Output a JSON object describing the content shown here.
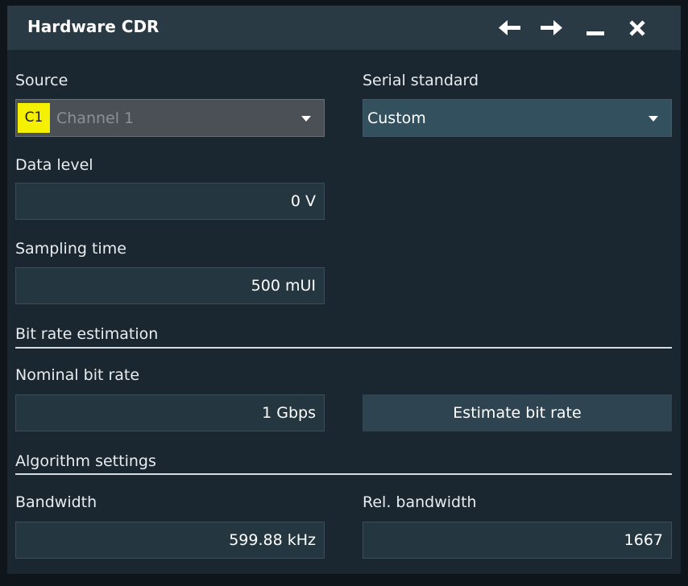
{
  "title": "Hardware CDR",
  "titlebar": {
    "icons": [
      "arrow-left-icon",
      "arrow-right-icon",
      "minimize-icon",
      "close-icon"
    ]
  },
  "source": {
    "label": "Source",
    "badge": "C1",
    "badge_color": "#f5f000",
    "value": "Channel 1"
  },
  "serial_standard": {
    "label": "Serial standard",
    "value": "Custom"
  },
  "data_level": {
    "label": "Data level",
    "value": "0 V"
  },
  "sampling_time": {
    "label": "Sampling time",
    "value": "500 mUI"
  },
  "bit_rate_estimation": {
    "heading": "Bit rate estimation",
    "nominal_label": "Nominal bit rate",
    "nominal_value": "1 Gbps",
    "estimate_button": "Estimate bit rate"
  },
  "algorithm_settings": {
    "heading": "Algorithm settings",
    "bandwidth_label": "Bandwidth",
    "bandwidth_value": "599.88 kHz",
    "rel_bandwidth_label": "Rel. bandwidth",
    "rel_bandwidth_value": "1667"
  }
}
